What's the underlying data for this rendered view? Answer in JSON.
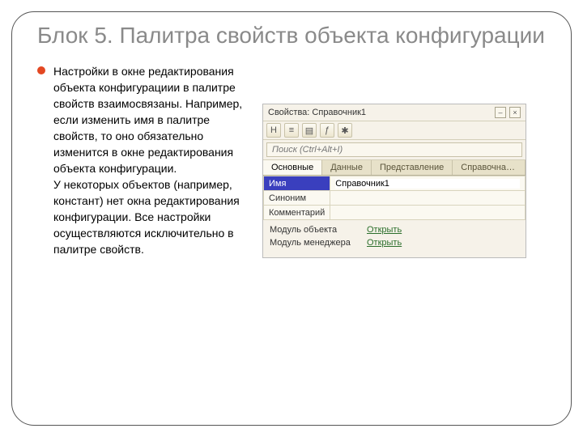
{
  "slide": {
    "title": "Блок 5. Палитра свойств объекта конфигурации",
    "bullet_text": "Настройки в окне редактирования объекта конфигурациии в палитре свойств взаимосвязаны. Например, если изменить имя в палитре свойств, то оно обязательно изменится в окне редактирования объекта конфигурации.\nУ некоторых объектов (например, констант) нет окна редактирования конфигурации. Все настройки осуществляются исключительно в палитре свойств."
  },
  "panel": {
    "title": "Свойства: Справочник1",
    "titlebar_buttons": {
      "min": "–",
      "close": "×"
    },
    "icons": [
      "H",
      "≡",
      "▤",
      "ƒ",
      "✱"
    ],
    "search_placeholder": "Поиск (Ctrl+Alt+I)",
    "tabs": [
      "Основные",
      "Данные",
      "Представление",
      "Справочная инфор..."
    ],
    "active_tab": 0,
    "rows": [
      {
        "label": "Имя",
        "value": "Справочник1"
      },
      {
        "label": "Синоним",
        "value": ""
      },
      {
        "label": "Комментарий",
        "value": ""
      }
    ],
    "links": [
      {
        "label": "Модуль объекта",
        "action": "Открыть"
      },
      {
        "label": "Модуль менеджера",
        "action": "Открыть"
      }
    ]
  }
}
